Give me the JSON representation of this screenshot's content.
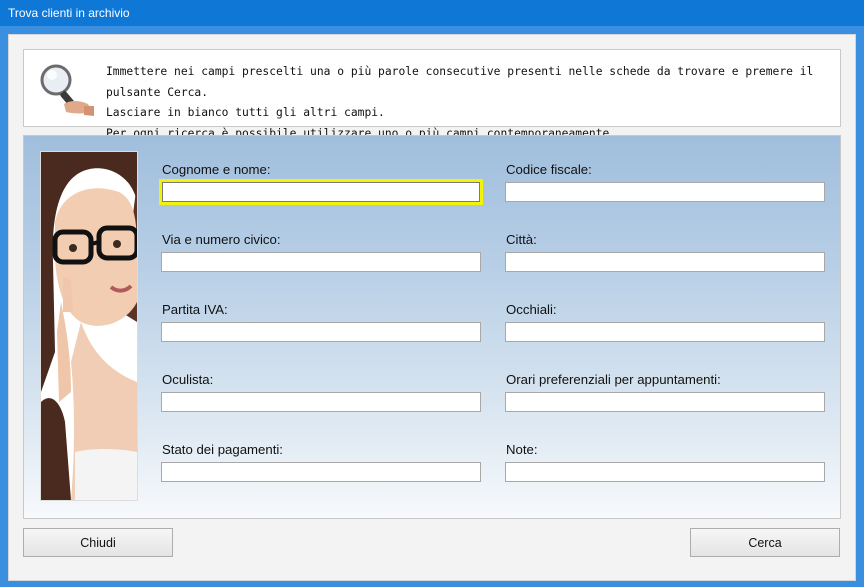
{
  "window": {
    "title": "Trova clienti in archivio"
  },
  "info": {
    "lines": [
      "Immettere nei campi prescelti una o più parole consecutive presenti nelle schede da trovare e premere il pulsante Cerca.",
      "Lasciare in bianco tutti gli altri campi.",
      "Per ogni ricerca è possibile utilizzare uno o più campi contemporaneamente."
    ],
    "icon": "magnifier-hand-icon"
  },
  "fields": {
    "cognome_nome": {
      "label": "Cognome e nome:",
      "value": ""
    },
    "codice_fiscale": {
      "label": "Codice fiscale:",
      "value": ""
    },
    "via": {
      "label": "Via e numero civico:",
      "value": ""
    },
    "citta": {
      "label": "Città:",
      "value": ""
    },
    "partita_iva": {
      "label": "Partita IVA:",
      "value": ""
    },
    "occhiali": {
      "label": "Occhiali:",
      "value": ""
    },
    "oculista": {
      "label": "Oculista:",
      "value": ""
    },
    "orari": {
      "label": "Orari preferenziali per appuntamenti:",
      "value": ""
    },
    "stato_pagamenti": {
      "label": "Stato dei pagamenti:",
      "value": ""
    },
    "note": {
      "label": "Note:",
      "value": ""
    }
  },
  "buttons": {
    "close": "Chiudi",
    "search": "Cerca"
  },
  "colors": {
    "titlebar": "#0f78d7",
    "focus_highlight": "#f3f30a"
  }
}
